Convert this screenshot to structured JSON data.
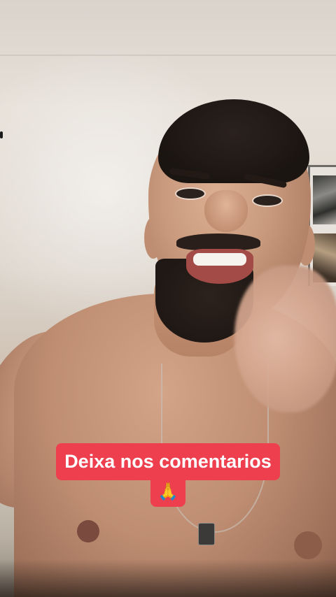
{
  "scene": {
    "subject": "selfie video frame",
    "caption": {
      "line1": "Deixa nos comentarios",
      "line2": "🙏"
    },
    "colors": {
      "caption_bg": "#ee3f4f",
      "caption_text": "#ffffff"
    }
  }
}
